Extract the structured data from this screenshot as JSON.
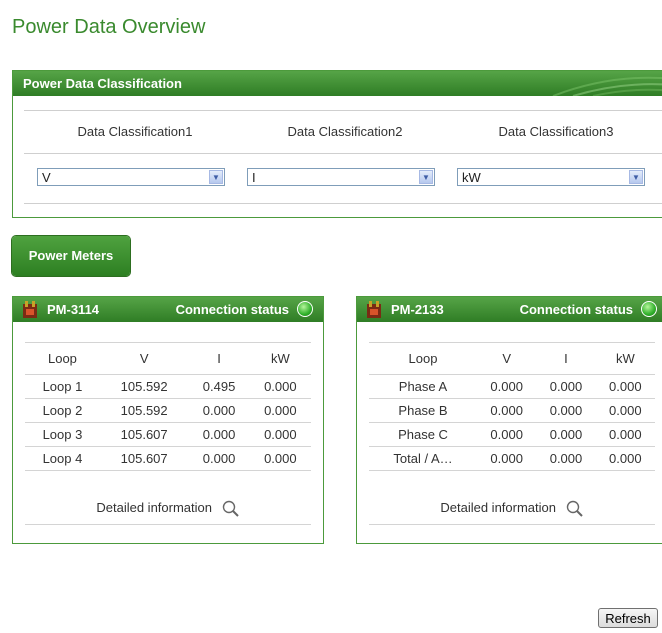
{
  "page": {
    "title": "Power Data Overview"
  },
  "classification": {
    "header": "Power Data Classification",
    "labels": [
      "Data Classification1",
      "Data Classification2",
      "Data Classification3"
    ],
    "selects": [
      "V",
      "I",
      "kW"
    ]
  },
  "power_meters_label": "Power Meters",
  "meters": [
    {
      "name": "PM-3114",
      "connection_label": "Connection status",
      "headers": [
        "Loop",
        "V",
        "I",
        "kW"
      ],
      "rows": [
        [
          "Loop 1",
          "105.592",
          "0.495",
          "0.000"
        ],
        [
          "Loop 2",
          "105.592",
          "0.000",
          "0.000"
        ],
        [
          "Loop 3",
          "105.607",
          "0.000",
          "0.000"
        ],
        [
          "Loop 4",
          "105.607",
          "0.000",
          "0.000"
        ]
      ],
      "detail_label": "Detailed information"
    },
    {
      "name": "PM-2133",
      "connection_label": "Connection status",
      "headers": [
        "Loop",
        "V",
        "I",
        "kW"
      ],
      "rows": [
        [
          "Phase A",
          "0.000",
          "0.000",
          "0.000"
        ],
        [
          "Phase B",
          "0.000",
          "0.000",
          "0.000"
        ],
        [
          "Phase C",
          "0.000",
          "0.000",
          "0.000"
        ],
        [
          "Total / A…",
          "0.000",
          "0.000",
          "0.000"
        ]
      ],
      "detail_label": "Detailed information"
    }
  ],
  "refresh_label": "Refresh",
  "colors": {
    "accent": "#3a8a2e",
    "header_green": "#2f7d25",
    "status_led": "#2fb02a"
  }
}
